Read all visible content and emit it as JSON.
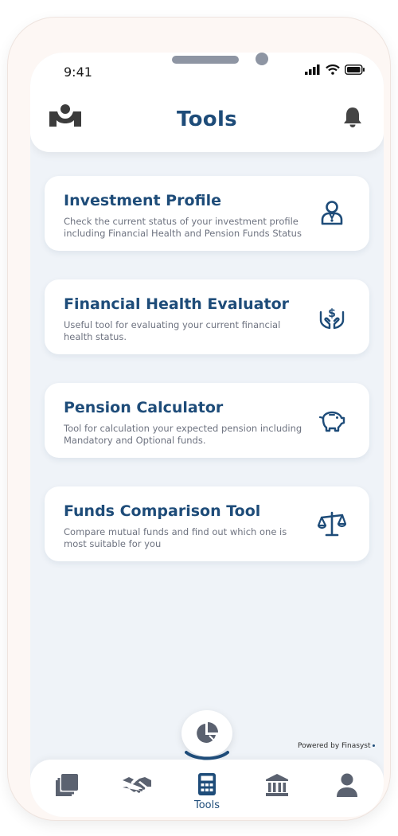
{
  "status_bar": {
    "time": "9:41"
  },
  "header": {
    "title": "Tools",
    "logo_icon": "brand-logo-icon",
    "bell_icon": "bell-icon"
  },
  "tools": [
    {
      "title": "Investment Profile",
      "description": "Check the current status of your investment profile including Financial Health and Pension Funds Status",
      "icon": "investor-profile-icon"
    },
    {
      "title": "Financial Health Evaluator",
      "description": "Useful tool for evaluating your current financial health status.",
      "icon": "hands-dollar-icon"
    },
    {
      "title": "Pension Calculator",
      "description": "Tool for calculation your expected pension including Mandatory and Optional funds.",
      "icon": "piggy-bank-icon"
    },
    {
      "title": "Funds Comparison Tool",
      "description": "Compare mutual funds and find out which one is most suitable for you",
      "icon": "balance-scale-icon"
    }
  ],
  "powered_by": "Powered by Finasyst",
  "bottom_nav": {
    "items": [
      {
        "icon": "cards-icon",
        "label": ""
      },
      {
        "icon": "handshake-icon",
        "label": ""
      },
      {
        "icon": "calculator-icon",
        "label": "Tools"
      },
      {
        "icon": "bank-icon",
        "label": ""
      },
      {
        "icon": "user-icon",
        "label": ""
      }
    ],
    "active_label": "Tools",
    "fab_icon": "pie-chart-icon"
  },
  "colors": {
    "primary": "#1e4c79",
    "icon_gray": "#5b6270",
    "background": "#eff3f8",
    "card": "#ffffff"
  }
}
